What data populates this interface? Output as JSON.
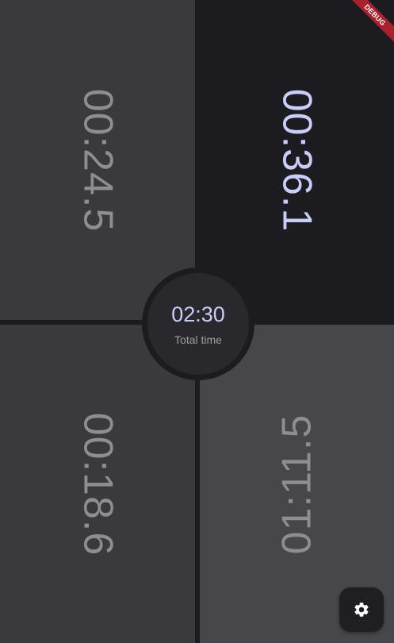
{
  "timers": {
    "top_left": "00:24.5",
    "top_right": "00:36.1",
    "bottom_left": "00:18.6",
    "bottom_right": "01:11.5"
  },
  "total": {
    "value": "02:30",
    "label": "Total time"
  },
  "debug_banner": "DEBUG",
  "icons": {
    "settings": "gear-icon"
  },
  "colors": {
    "active_timer": "#c9cdfa",
    "inactive_timer": "#8e8d91",
    "background": "#1c1b1f",
    "debug_ribbon": "#a8222d"
  }
}
